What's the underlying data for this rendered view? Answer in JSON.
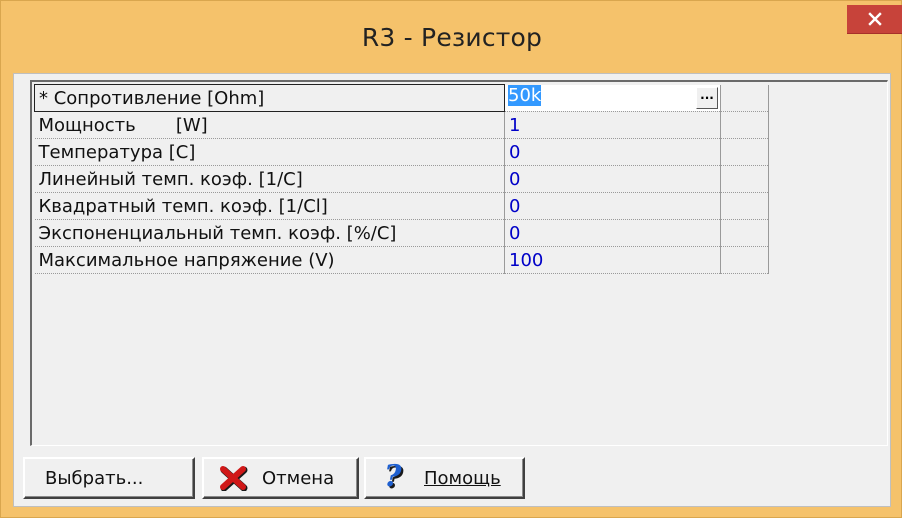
{
  "window": {
    "title": "R3 - Резистор",
    "frame_color": "#F5C26B",
    "close_color": "#C7433A"
  },
  "properties": [
    {
      "name": "* Сопротивление [Ohm]",
      "value": "50k",
      "selected": true
    },
    {
      "name": "Мощность       [W]",
      "value": "1"
    },
    {
      "name": "Температура [C]",
      "value": "0"
    },
    {
      "name": "Линейный темп. коэф. [1/C]",
      "value": "0"
    },
    {
      "name": "Квадратный темп. коэф. [1/Cl]",
      "value": "0"
    },
    {
      "name": "Экспоненциальный темп. коэф. [%/C]",
      "value": "0"
    },
    {
      "name": "Максимальное напряжение (V)",
      "value": "100"
    }
  ],
  "value_editor": {
    "button_label": "..."
  },
  "buttons": {
    "choose": "Выбрать...",
    "cancel": "Отмена",
    "help": "Помощь"
  },
  "icons": {
    "close": "close-icon",
    "cancel": "red-x-icon",
    "help": "question-mark-icon"
  },
  "colors": {
    "value_text": "#0000c8",
    "selection": "#3399ff"
  }
}
